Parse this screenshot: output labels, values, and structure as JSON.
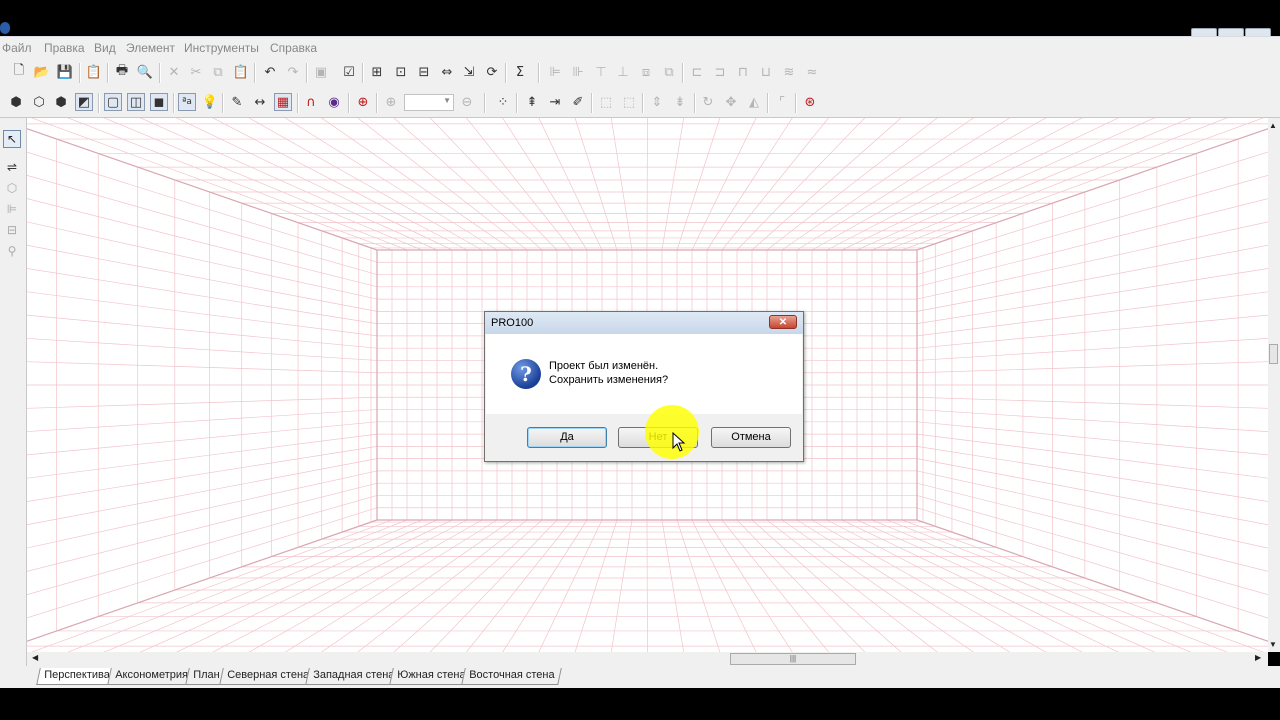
{
  "window": {
    "title": "PRO100"
  },
  "menu": [
    "Файл",
    "Правка",
    "Вид",
    "Элемент",
    "Инструменты",
    "Справка"
  ],
  "icons": {
    "toolbar1": [
      "new-file-icon",
      "open-folder-icon",
      "save-icon",
      "properties-icon",
      "print-icon",
      "print-preview-icon",
      "delete-icon",
      "cut-icon",
      "copy-icon",
      "paste-icon",
      "undo-icon",
      "redo-icon",
      "library-icon",
      "checklist-icon",
      "view-icon",
      "zoom-window-icon",
      "insert-element-icon",
      "size-icon",
      "export-icon",
      "refresh-icon",
      "sum-icon"
    ],
    "toolbar2": [
      "cube-icon",
      "cube-outline-icon",
      "cube-filled-icon",
      "solid-view-icon",
      "wireframe-icon",
      "outline-icon",
      "colored-icon",
      "text-label-icon",
      "light-bulb-icon",
      "paint-icon",
      "measure-icon",
      "grid-icon",
      "magnet-icon",
      "texture-icon",
      "target-icon",
      "zoom-in-icon",
      "zoom-out-icon"
    ],
    "left": [
      "pointer-icon",
      "flip-icon",
      "rotate-icon",
      "align-icon",
      "distribute-icon",
      "zoom-icon"
    ]
  },
  "tabs": [
    "Перспектива",
    "Аксонометрия",
    "План",
    "Северная стена",
    "Западная стена",
    "Южная стена",
    "Восточная стена"
  ],
  "active_tab": "Перспектива",
  "dialog": {
    "title": "PRO100",
    "close_label": "✕",
    "message_line1": "Проект был изменён.",
    "message_line2": "Сохранить изменения?",
    "buttons": {
      "yes": "Да",
      "no": "Нет",
      "cancel": "Отмена"
    }
  },
  "colors": {
    "grid": "#f2c4cc",
    "room_edges": "#d9a8b2",
    "dialog_accent": "#3c7fb1"
  }
}
